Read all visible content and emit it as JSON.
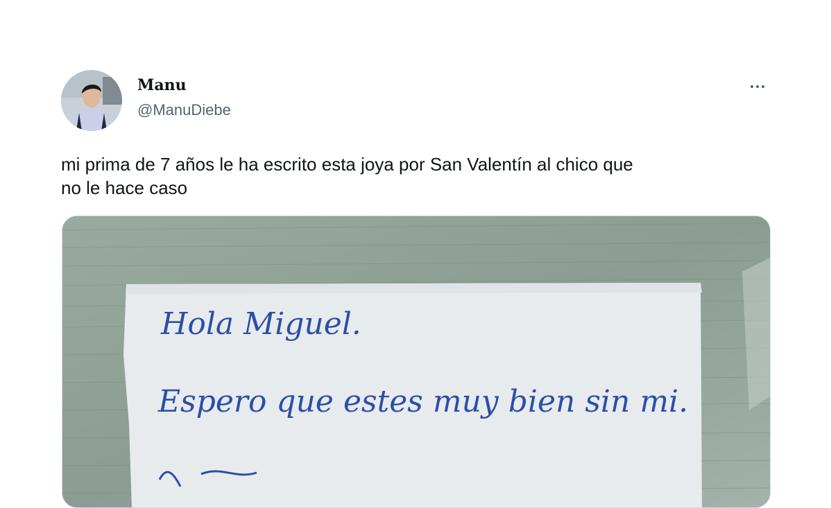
{
  "tweet": {
    "author": {
      "display_name": "Manu",
      "handle": "@ManuDiebe",
      "avatar_icon": "profile-photo"
    },
    "more_icon": "more-horizontal-icon",
    "text": "mi prima de 7 años le ha escrito esta joya por San Valentín al chico que\nno le hace caso",
    "media": {
      "note_lines": [
        "Hola Miguel.",
        "Espero que estes muy bien sin mi."
      ]
    }
  },
  "colors": {
    "text_primary": "#0f1419",
    "text_secondary": "#536471",
    "ink": "#2b4fa8",
    "paper": "#e9ecef",
    "table": "#8fa096"
  }
}
